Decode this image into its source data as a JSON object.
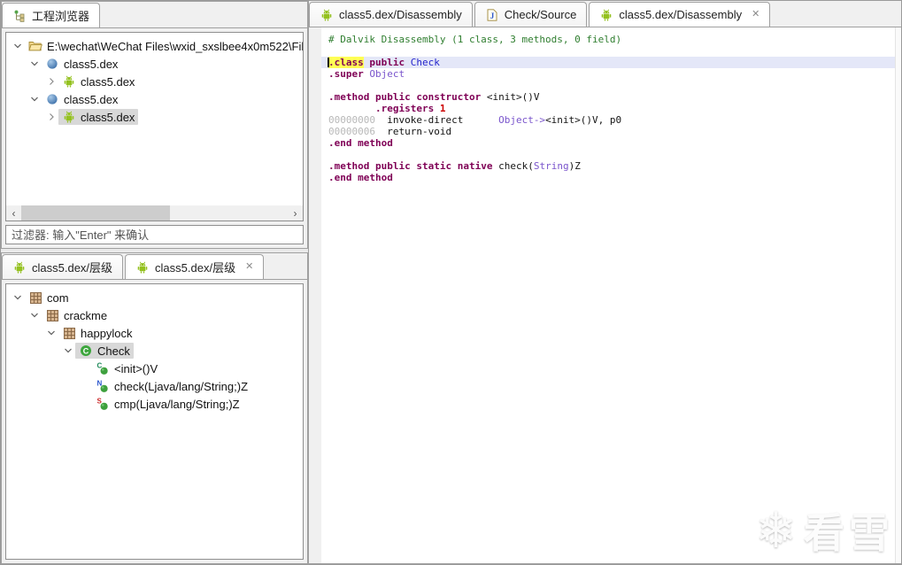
{
  "colors": {
    "background": "#f0f0f0",
    "panel_border": "#a0a0a0",
    "selection": "#d8d8d8",
    "keyword": "#7f0055",
    "comment": "#2f7e2f",
    "class_name": "#2424cc",
    "type": "#7a55cc",
    "address": "#b8b8b8",
    "number": "#cc0000",
    "current_line": "#e4e7f8",
    "search_highlight": "#ffff55",
    "android_green": "#94c11f"
  },
  "left_top_panel": {
    "tab": {
      "label": "工程浏览器",
      "icon": "project-tree-icon"
    },
    "tree_items": [
      {
        "level": 0,
        "chevron": "expanded",
        "icon": "folder-open-icon",
        "label": "E:\\wechat\\WeChat Files\\wxid_sxslbee4x0m522\\Fil",
        "selected": false
      },
      {
        "level": 1,
        "chevron": "expanded",
        "icon": "dex-file-icon",
        "label": "class5.dex",
        "selected": false
      },
      {
        "level": 2,
        "chevron": "collapsed",
        "icon": "android-icon",
        "label": "class5.dex",
        "selected": false
      },
      {
        "level": 1,
        "chevron": "expanded",
        "icon": "dex-file-icon",
        "label": "class5.dex",
        "selected": false
      },
      {
        "level": 2,
        "chevron": "collapsed",
        "icon": "android-icon",
        "label": "class5.dex",
        "selected": true
      }
    ],
    "scrollbar": {
      "left_icon": "scroll-left-arrow-icon",
      "right_icon": "scroll-right-arrow-icon"
    },
    "filter_placeholder": "过滤器: 输入\"Enter\" 来确认"
  },
  "left_bottom_panel": {
    "tabs": [
      {
        "label": "class5.dex/层级",
        "icon": "android-icon",
        "active": false,
        "closable": false
      },
      {
        "label": "class5.dex/层级",
        "icon": "android-icon",
        "active": true,
        "closable": true
      }
    ],
    "tree_items": [
      {
        "level": 0,
        "chevron": "expanded",
        "icon": "package-icon",
        "label": "com",
        "selected": false
      },
      {
        "level": 1,
        "chevron": "expanded",
        "icon": "package-icon",
        "label": "crackme",
        "selected": false
      },
      {
        "level": 2,
        "chevron": "expanded",
        "icon": "package-icon",
        "label": "happylock",
        "selected": false
      },
      {
        "level": 3,
        "chevron": "expanded",
        "icon": "class-icon",
        "label": "Check",
        "selected": true
      },
      {
        "level": 4,
        "chevron": "none",
        "icon": "method-constructor-icon",
        "label": "<init>()V",
        "selected": false
      },
      {
        "level": 4,
        "chevron": "none",
        "icon": "method-native-icon",
        "label": "check(Ljava/lang/String;)Z",
        "selected": false
      },
      {
        "level": 4,
        "chevron": "none",
        "icon": "method-static-icon",
        "label": "cmp(Ljava/lang/String;)Z",
        "selected": false
      }
    ]
  },
  "editor_panel": {
    "tabs": [
      {
        "label": "class5.dex/Disassembly",
        "icon": "android-icon",
        "active": false,
        "closable": false
      },
      {
        "label": "Check/Source",
        "icon": "java-source-icon",
        "active": false,
        "closable": false
      },
      {
        "label": "class5.dex/Disassembly",
        "icon": "android-icon",
        "active": true,
        "closable": true
      }
    ],
    "code_lines": [
      {
        "segments": [
          [
            "comment",
            "# Dalvik Disassembly (1 class, 3 methods, 0 field)"
          ]
        ]
      },
      {
        "segments": []
      },
      {
        "current": true,
        "caret": true,
        "segments": [
          [
            "kw hl",
            ".class"
          ],
          [
            "plain",
            " "
          ],
          [
            "kw",
            "public"
          ],
          [
            "plain",
            " "
          ],
          [
            "classname",
            "Check"
          ]
        ]
      },
      {
        "segments": [
          [
            "kw",
            ".super"
          ],
          [
            "plain",
            " "
          ],
          [
            "type",
            "Object"
          ]
        ]
      },
      {
        "segments": []
      },
      {
        "segments": [
          [
            "kw",
            ".method"
          ],
          [
            "plain",
            " "
          ],
          [
            "kw",
            "public"
          ],
          [
            "plain",
            " "
          ],
          [
            "kw",
            "constructor"
          ],
          [
            "plain",
            " "
          ],
          [
            "plain",
            "<init>()V"
          ]
        ]
      },
      {
        "segments": [
          [
            "plain",
            "        "
          ],
          [
            "kw",
            ".registers"
          ],
          [
            "plain",
            " "
          ],
          [
            "num",
            "1"
          ]
        ]
      },
      {
        "segments": [
          [
            "addr",
            "00000000"
          ],
          [
            "plain",
            "  "
          ],
          [
            "plain",
            "invoke-direct"
          ],
          [
            "plain",
            "      "
          ],
          [
            "type",
            "Object->"
          ],
          [
            "plain",
            "<init>()V, p0"
          ]
        ]
      },
      {
        "segments": [
          [
            "addr",
            "00000006"
          ],
          [
            "plain",
            "  "
          ],
          [
            "plain",
            "return-void"
          ]
        ]
      },
      {
        "segments": [
          [
            "kw",
            ".end method"
          ]
        ]
      },
      {
        "segments": []
      },
      {
        "segments": [
          [
            "kw",
            ".method"
          ],
          [
            "plain",
            " "
          ],
          [
            "kw",
            "public"
          ],
          [
            "plain",
            " "
          ],
          [
            "kw",
            "static"
          ],
          [
            "plain",
            " "
          ],
          [
            "kw",
            "native"
          ],
          [
            "plain",
            " "
          ],
          [
            "plain",
            "check("
          ],
          [
            "type",
            "String"
          ],
          [
            "plain",
            ")Z"
          ]
        ]
      },
      {
        "segments": [
          [
            "kw",
            ".end method"
          ]
        ]
      }
    ],
    "watermark": {
      "icon": "snowflake-icon",
      "text": "看雪"
    }
  }
}
